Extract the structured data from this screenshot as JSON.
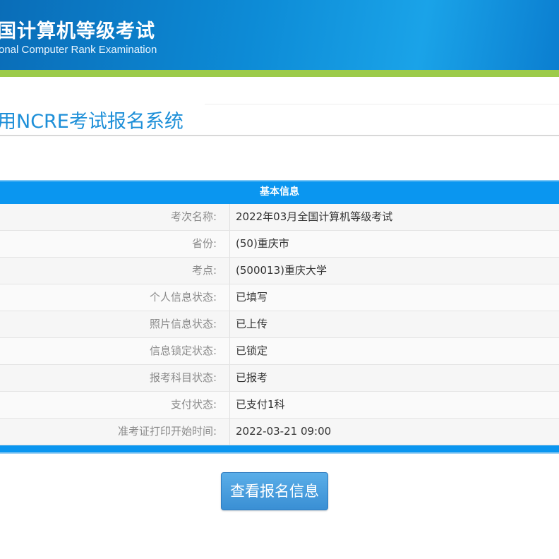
{
  "header": {
    "title_cn": "国计算机等级考试",
    "title_en": "onal Computer Rank Examination"
  },
  "system_title": "用NCRE考试报名系统",
  "table": {
    "heading": "基本信息",
    "rows": [
      {
        "label": "考次名称:",
        "value": "2022年03月全国计算机等级考试"
      },
      {
        "label": "省份:",
        "value": "(50)重庆市"
      },
      {
        "label": "考点:",
        "value": "(500013)重庆大学"
      },
      {
        "label": "个人信息状态:",
        "value": "已填写"
      },
      {
        "label": "照片信息状态:",
        "value": "已上传"
      },
      {
        "label": "信息锁定状态:",
        "value": "已锁定"
      },
      {
        "label": "报考科目状态:",
        "value": "已报考"
      },
      {
        "label": "支付状态:",
        "value": "已支付1科"
      },
      {
        "label": "准考证打印开始时间:",
        "value": "2022-03-21 09:00"
      }
    ]
  },
  "button": {
    "label": "查看报名信息"
  },
  "colors": {
    "accent": "#0a96f0",
    "green": "#9ccb4a",
    "title": "#1d8fd8"
  }
}
